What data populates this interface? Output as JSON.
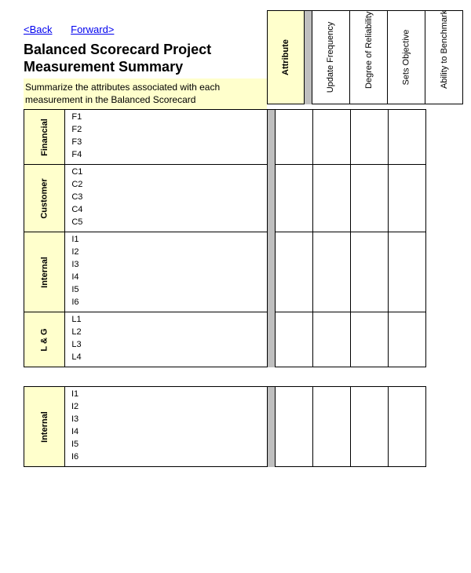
{
  "nav": {
    "back": "<Back",
    "forward": "Forward>"
  },
  "title": "Balanced Scorecard Project Measurement Summary",
  "subtitle": "Summarize the attributes associated with each measurement in the Balanced Scorecard",
  "columns": {
    "attribute": "Attribute",
    "update_frequency": "Update Frequency",
    "degree_reliability": "Degree of Reliability",
    "sets_objective": "Sets Objective",
    "ability_benchmark": "Ability to Benchmark"
  },
  "perspectives": [
    {
      "name": "Financial",
      "items": [
        "F1",
        "F2",
        "F3",
        "F4"
      ]
    },
    {
      "name": "Customer",
      "items": [
        "C1",
        "C2",
        "C3",
        "C4",
        "C5"
      ]
    },
    {
      "name": "Internal",
      "items": [
        "I1",
        "I2",
        "I3",
        "I4",
        "I5",
        "I6"
      ]
    },
    {
      "name": "L & G",
      "items": [
        "L1",
        "L2",
        "L3",
        "L4"
      ]
    }
  ],
  "second_table": [
    {
      "name": "Internal",
      "items": [
        "I1",
        "I2",
        "I3",
        "I4",
        "I5",
        "I6"
      ]
    }
  ]
}
